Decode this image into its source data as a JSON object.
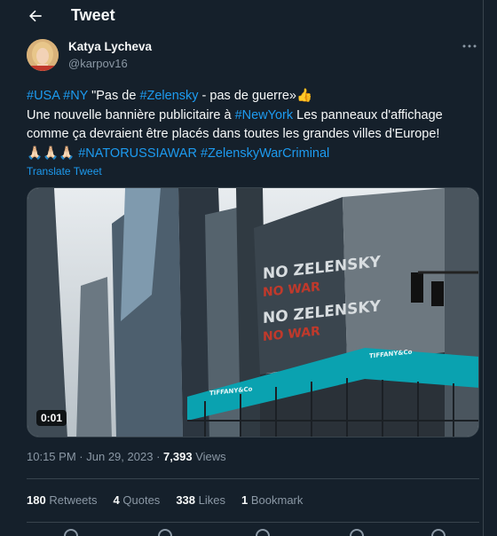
{
  "header": {
    "title": "Tweet"
  },
  "author": {
    "name": "Katya Lycheva",
    "handle": "@karpov16"
  },
  "tweet": {
    "line1_tags": [
      "#USA",
      "#NY"
    ],
    "line1_text": " \"Pas de ",
    "line1_tag2": "#Zelensky",
    "line1_text2": " - pas de guerre»",
    "line1_emoji": "👍",
    "line2_text": "Une nouvelle bannière publicitaire à ",
    "line2_tag": "#NewYork",
    "line2_text2": " Les panneaux d'affichage comme ça devraient être placés dans toutes les grandes villes d'Europe!",
    "line3_emoji": "🙏🏻🙏🏻🙏🏻",
    "line3_tags": [
      "#NATORUSSIAWAR",
      "#ZelenskyWarCriminal"
    ],
    "translate": "Translate Tweet"
  },
  "media": {
    "duration": "0:01",
    "banner_lines": [
      "NO ZELENSKY",
      "NO WAR",
      "NO ZELENSKY",
      "NO WAR"
    ],
    "store_label": "TIFFANY&Co"
  },
  "meta": {
    "time": "10:15 PM",
    "sep": "·",
    "date": "Jun 29, 2023",
    "views_count": "7,393",
    "views_label": "Views"
  },
  "stats": [
    {
      "count": "180",
      "label": "Retweets"
    },
    {
      "count": "4",
      "label": "Quotes"
    },
    {
      "count": "338",
      "label": "Likes"
    },
    {
      "count": "1",
      "label": "Bookmark"
    }
  ],
  "colors": {
    "background": "#15202b",
    "accent": "#1d9bf0",
    "muted": "#8b98a5",
    "border": "#38444d"
  }
}
